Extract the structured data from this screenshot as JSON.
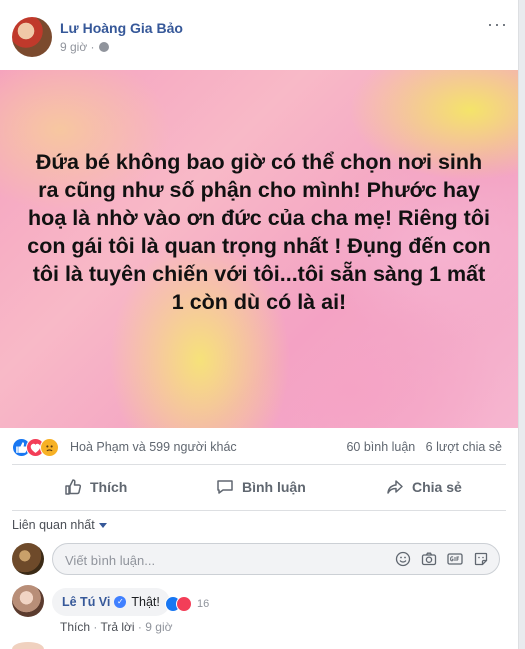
{
  "post": {
    "author": "Lư Hoàng Gia Bảo",
    "time": "9 giờ ·",
    "more": "···",
    "banner_text": "Đứa bé không bao giờ có thể chọn nơi sinh ra cũng như số phận cho mình! Phước hay hoạ là nhờ vào ơn đức của cha mẹ! Riêng tôi con gái tôi là quan trọng nhất ! Đụng đến con tôi là tuyên chiến với tôi...tôi sẵn sàng 1 mất 1 còn dù có là ai!"
  },
  "stats": {
    "reactions_text": "Hoà Phạm và 599 người khác",
    "comments": "60 bình luận",
    "shares": "6 lượt chia sẻ"
  },
  "actions": {
    "like": "Thích",
    "comment": "Bình luận",
    "share": "Chia sẻ"
  },
  "comments_section": {
    "sort_label": "Liên quan nhất",
    "input_placeholder": "Viết bình luận...",
    "input_icons": [
      "emoji-icon",
      "camera-icon",
      "gif-icon",
      "sticker-icon"
    ]
  },
  "comment": {
    "author": "Lê Tú Vi",
    "text": "Thật!",
    "reaction_count": "16",
    "like_label": "Thích",
    "reply_label": "Trả lời",
    "time": "9 giờ"
  },
  "colors": {
    "link": "#365899",
    "like": "#1877f2",
    "love": "#f33e58",
    "sad": "#f7b125",
    "muted": "#90949c"
  }
}
